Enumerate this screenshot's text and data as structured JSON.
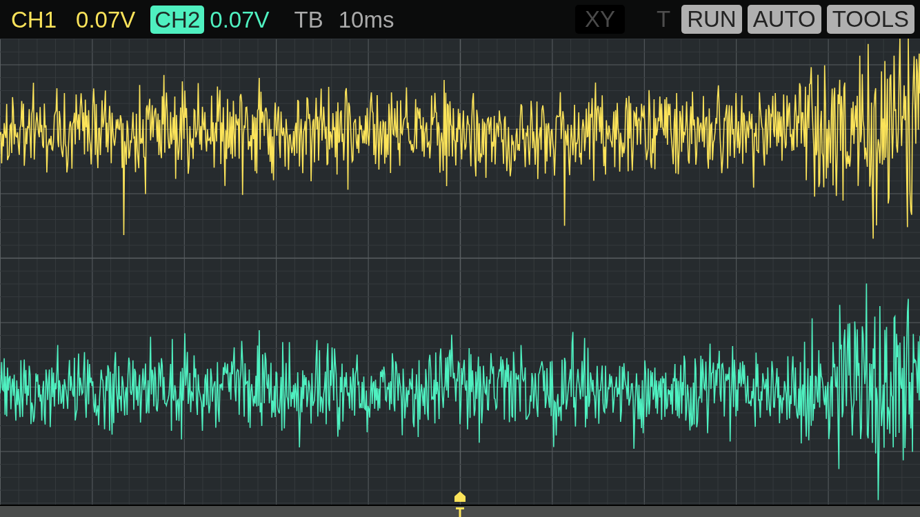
{
  "channels": [
    {
      "label": "CH1",
      "reading": "0.07V",
      "color": "#fbe35a",
      "selected": false
    },
    {
      "label": "CH2",
      "reading": "0.07V",
      "color": "#4ff0c0",
      "selected": true
    }
  ],
  "timebase": {
    "label": "TB",
    "value": "10ms"
  },
  "buttons": [
    {
      "label": "XY",
      "kind": "box",
      "disabled": true
    },
    {
      "label": "T",
      "kind": "plain",
      "disabled": true
    },
    {
      "label": "RUN",
      "kind": "box",
      "disabled": false
    },
    {
      "label": "AUTO",
      "kind": "box",
      "disabled": false
    },
    {
      "label": "TOOLS",
      "kind": "box",
      "disabled": false
    }
  ]
}
